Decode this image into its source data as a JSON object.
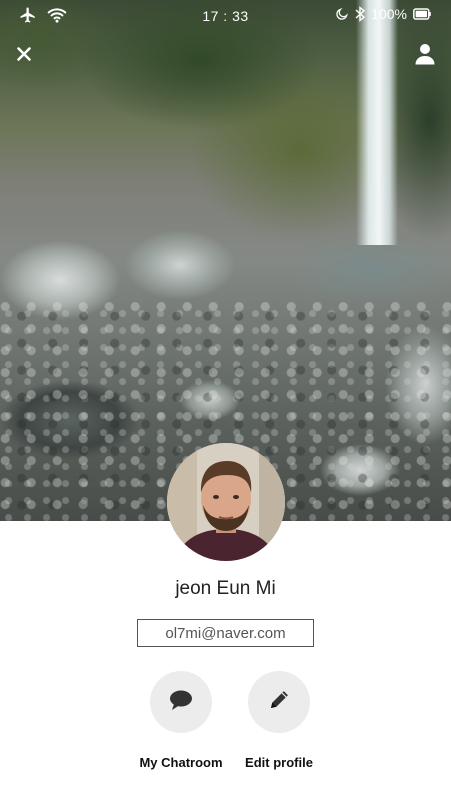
{
  "status_bar": {
    "time": "17 : 33",
    "battery": "100%",
    "icons": [
      "airplane-icon",
      "wifi-icon",
      "moon-icon",
      "bluetooth-icon",
      "battery-icon"
    ]
  },
  "header": {
    "close_icon": "close-icon",
    "profile_icon": "user-icon"
  },
  "profile": {
    "name": "jeon Eun Mi",
    "email": "ol7mi@naver.com"
  },
  "actions": [
    {
      "label": "My Chatroom",
      "icon": "chat-bubble-icon"
    },
    {
      "label": "Edit profile",
      "icon": "pencil-icon"
    }
  ],
  "colors": {
    "button_bg": "#ececec",
    "text": "#222222",
    "icon_dark": "#333333"
  }
}
